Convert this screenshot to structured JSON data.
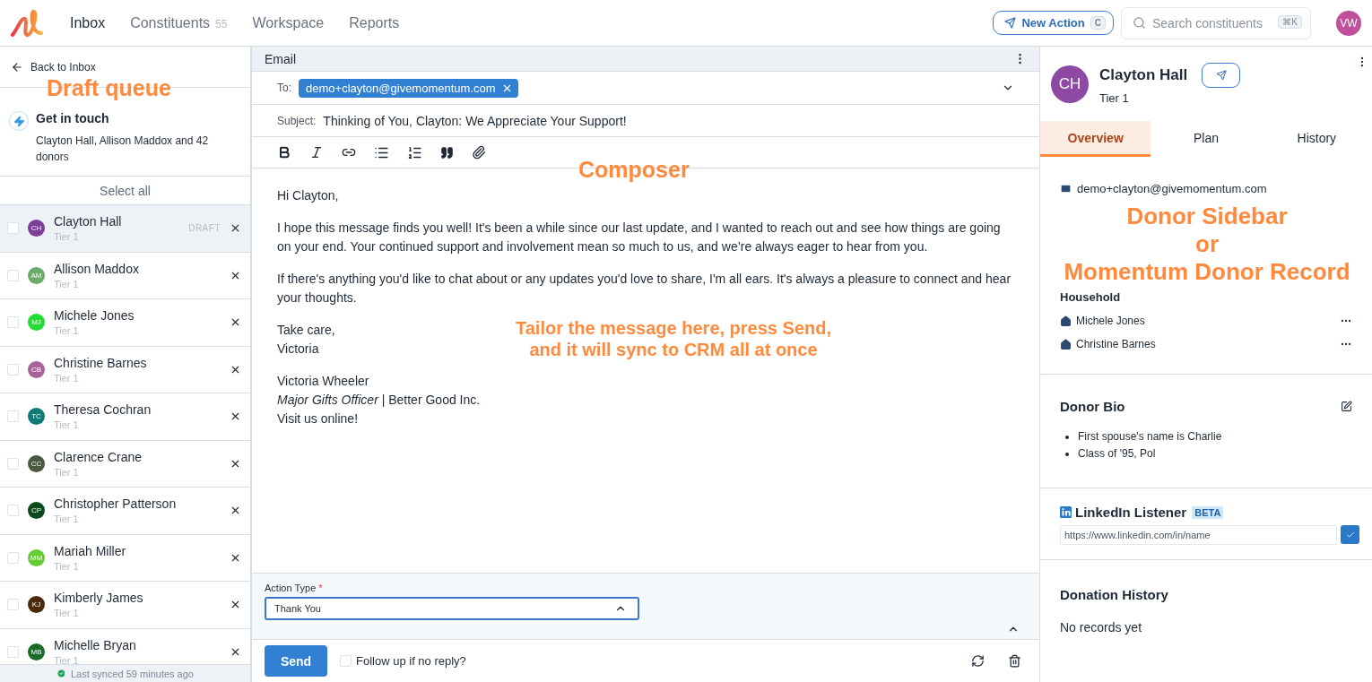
{
  "nav": {
    "items": [
      {
        "label": "Inbox",
        "selected": true
      },
      {
        "label": "Constituents",
        "count": "55",
        "selected": false
      },
      {
        "label": "Workspace",
        "selected": false
      },
      {
        "label": "Reports",
        "selected": false
      }
    ],
    "new_action": {
      "label": "New Action",
      "shortcut": "C"
    },
    "search": {
      "placeholder": "Search constituents",
      "shortcut": "⌘K"
    },
    "avatar": "VW"
  },
  "queue": {
    "back": "Back to Inbox",
    "annotation": "Draft queue",
    "title": "Get in touch",
    "subtitle": "Clayton Hall, Allison Maddox and 42 donors",
    "select_all": "Select all",
    "rows": [
      {
        "name": "Clayton Hall",
        "initials": "CH",
        "tier": "Tier 1",
        "color": "#7b3f99",
        "badge": "DRAFT",
        "selected": true,
        "checked": false
      },
      {
        "name": "Allison Maddox",
        "initials": "AM",
        "tier": "Tier 1",
        "color": "#6aaa6a",
        "selected": false,
        "checked": false
      },
      {
        "name": "Michele Jones",
        "initials": "MJ",
        "tier": "Tier 1",
        "color": "#22dd33",
        "selected": false,
        "checked": false
      },
      {
        "name": "Christine Barnes",
        "initials": "CB",
        "tier": "Tier 1",
        "color": "#a8649a",
        "selected": false,
        "checked": false
      },
      {
        "name": "Theresa Cochran",
        "initials": "TC",
        "tier": "Tier 1",
        "color": "#0f7a78",
        "selected": false,
        "checked": false
      },
      {
        "name": "Clarence Crane",
        "initials": "CC",
        "tier": "Tier 1",
        "color": "#4a5a40",
        "selected": false,
        "checked": false
      },
      {
        "name": "Christopher Patterson",
        "initials": "CP",
        "tier": "Tier 1",
        "color": "#0b4a1a",
        "selected": false,
        "checked": false
      },
      {
        "name": "Mariah Miller",
        "initials": "MM",
        "tier": "Tier 1",
        "color": "#66cc33",
        "selected": false,
        "checked": false
      },
      {
        "name": "Kimberly James",
        "initials": "KJ",
        "tier": "Tier 1",
        "color": "#4a2a0a",
        "selected": false,
        "checked": false
      },
      {
        "name": "Michelle Bryan",
        "initials": "MB",
        "tier": "Tier 1",
        "color": "#1a6a2a",
        "selected": false,
        "checked": false
      }
    ],
    "sync": "Last synced 59 minutes ago"
  },
  "composer": {
    "title": "Email",
    "to_label": "To:",
    "recipient": "demo+clayton@givemomentum.com",
    "subject_label": "Subject:",
    "subject": "Thinking of You, Clayton: We Appreciate Your Support!",
    "annotation": "Composer",
    "note": "Tailor the message here, press Send, and it will sync to CRM all at once",
    "body": [
      "Hi Clayton,",
      "I hope this message finds you well! It's been a while since our last update, and I wanted to reach out and see how things are going on your end. Your continued support and involvement mean so much to us, and we’re always eager to hear from you.",
      "If there's anything you'd like to chat about or any updates you'd love to share, I'm all ears. It's always a pleasure to connect and hear your thoughts."
    ],
    "closing": [
      "Take care,",
      "Victoria"
    ],
    "signature": [
      "Victoria Wheeler",
      "*Major Gifts Officer* | Better Good Inc.",
      "Visit us online!"
    ],
    "action_type": {
      "label": "Action Type",
      "required_mark": "*",
      "value": "Thank You",
      "expanded": true
    },
    "send": "Send",
    "follow_up": {
      "label": "Follow up if no reply?",
      "checked": false
    }
  },
  "donor": {
    "initials": "CH",
    "name": "Clayton Hall",
    "tier": "Tier 1",
    "tabs": [
      {
        "label": "Overview",
        "selected": true
      },
      {
        "label": "Plan",
        "selected": false
      },
      {
        "label": "History",
        "selected": false
      }
    ],
    "email": "demo+clayton@givemomentum.com",
    "annotation": [
      "Donor Sidebar",
      "or",
      "Momentum Donor Record"
    ],
    "household_title": "Household",
    "household": [
      "Michele Jones",
      "Christine Barnes"
    ],
    "bio_title": "Donor Bio",
    "bio": [
      "First spouse's name is Charlie",
      "Class of '95, Pol"
    ],
    "linkedin": {
      "title": "LinkedIn Listener",
      "badge": "BETA",
      "placeholder": "https://www.linkedin.com/in/name"
    },
    "donations_title": "Donation History",
    "donations_empty": "No records yet"
  }
}
